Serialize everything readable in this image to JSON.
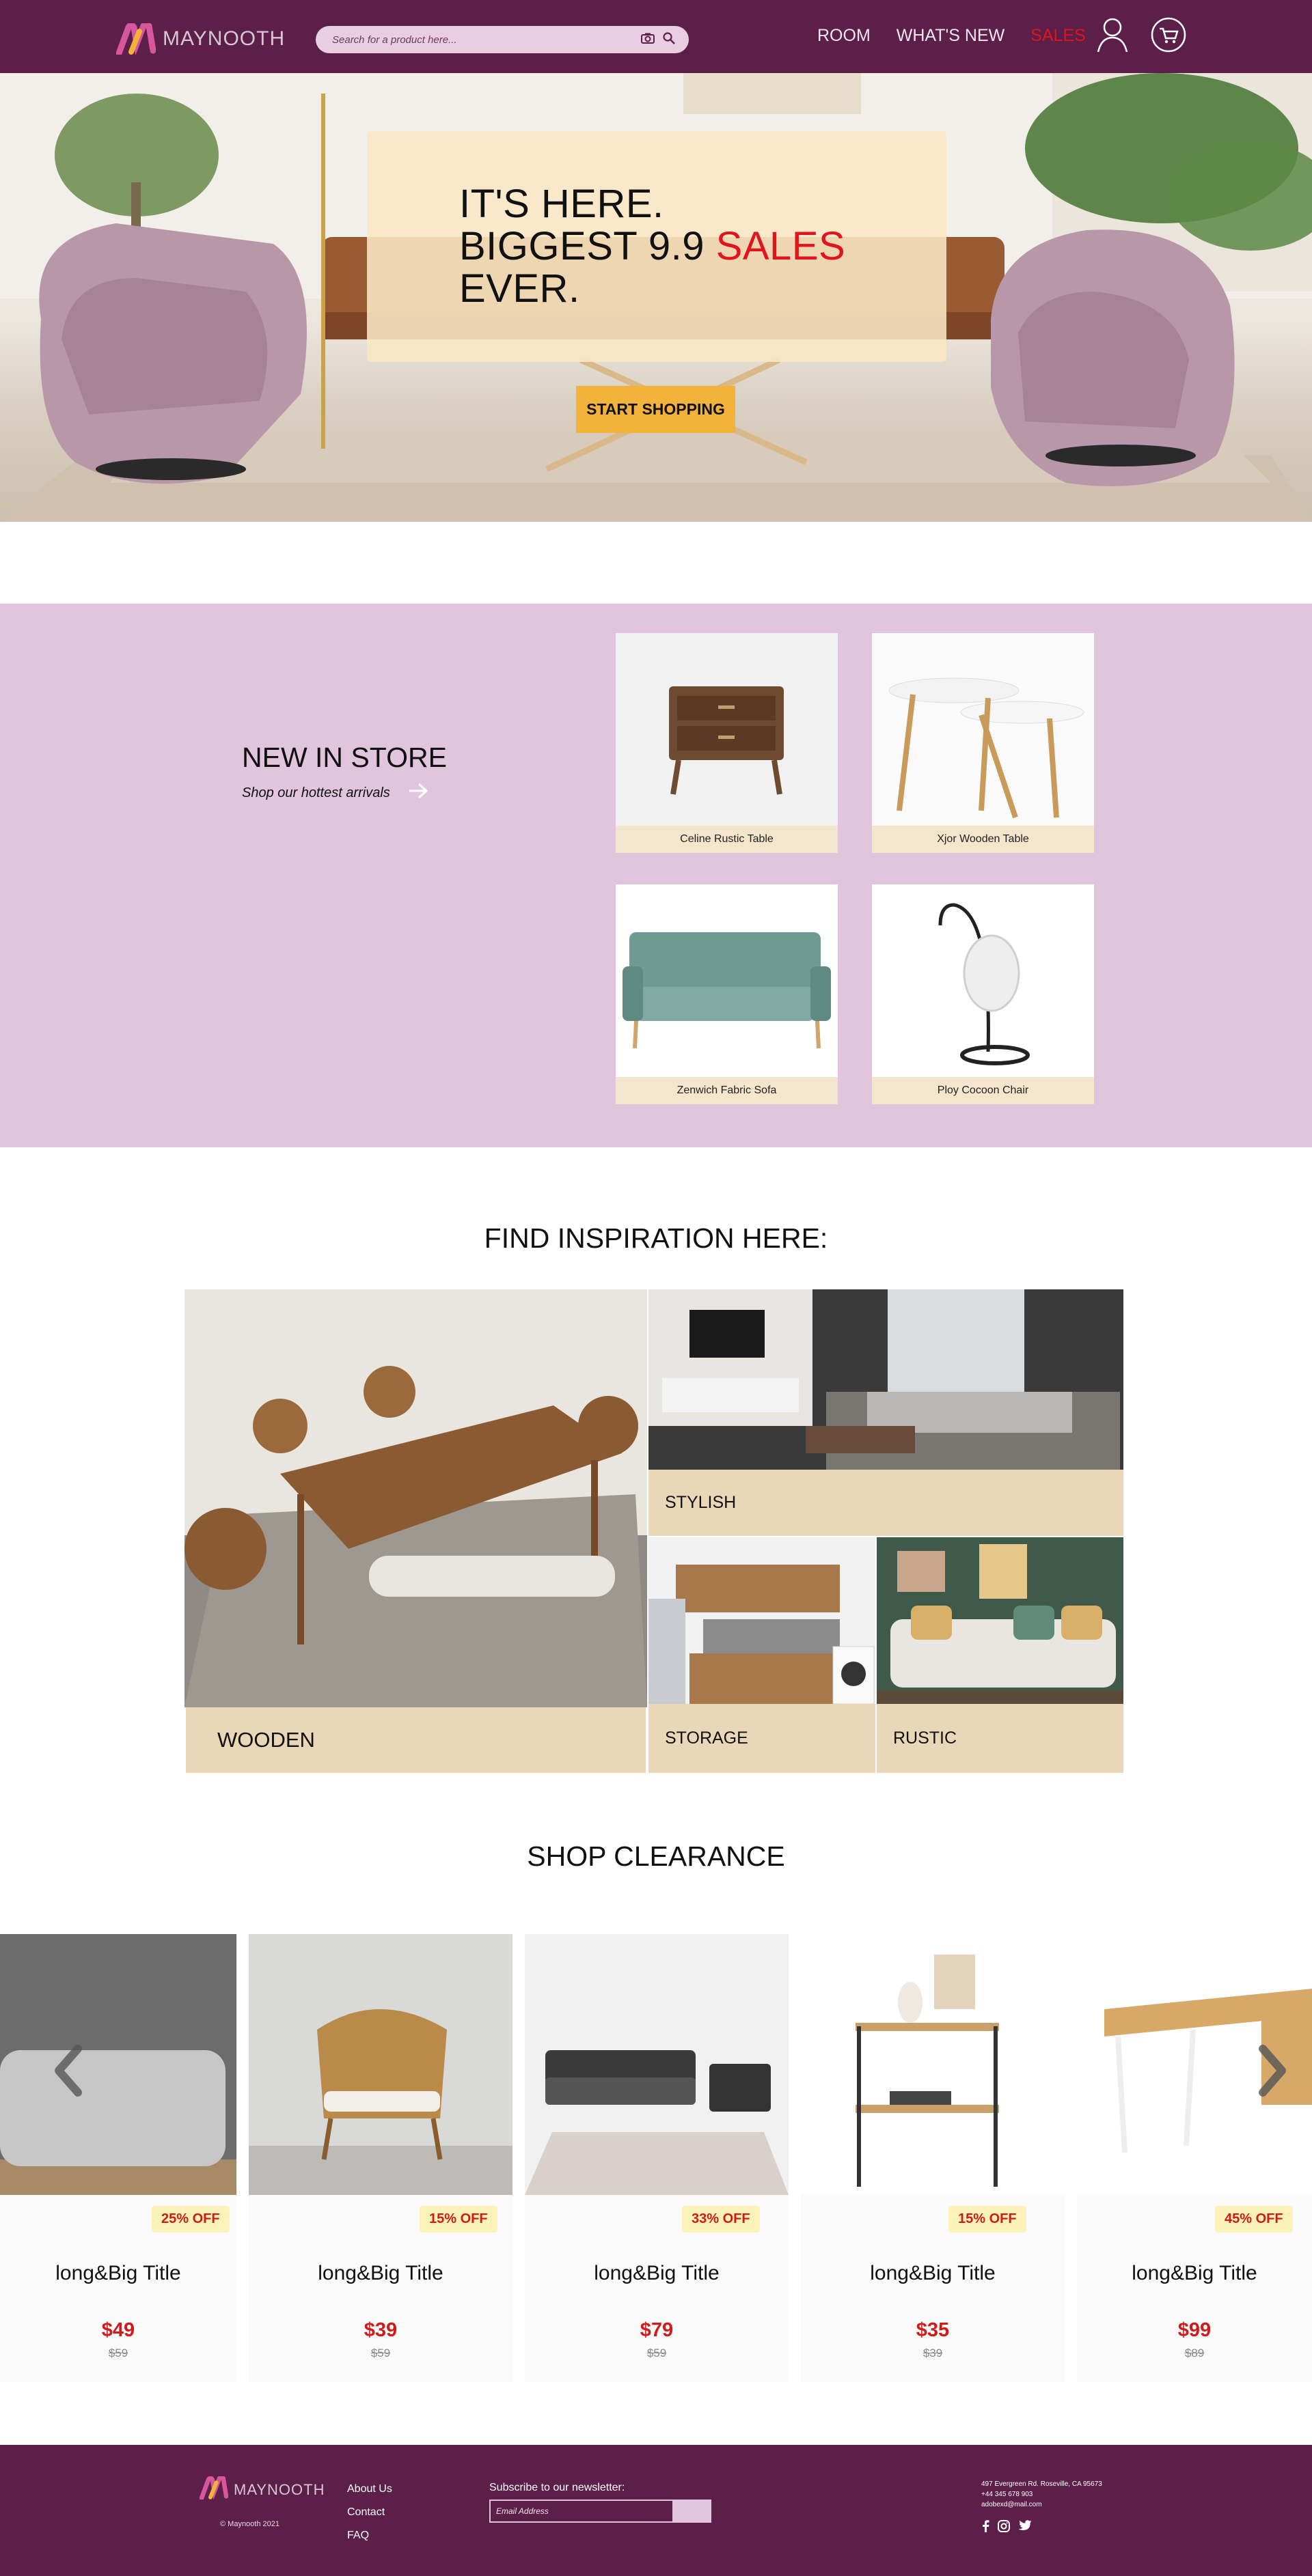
{
  "brand": {
    "name": "MAYNOOTH"
  },
  "search": {
    "placeholder": "Search for a product here..."
  },
  "nav": [
    {
      "label": "ROOM"
    },
    {
      "label": "WHAT'S NEW"
    },
    {
      "label": "SALES"
    }
  ],
  "hero": {
    "line1": "IT'S HERE.",
    "line2_prefix": "BIGGEST 9.9 ",
    "line2_highlight": "SALES",
    "line3": "EVER.",
    "cta": "START SHOPPING"
  },
  "new_in": {
    "title": "NEW IN STORE",
    "subtitle": "Shop our hottest arrivals",
    "products": [
      {
        "name": "Celine Rustic Table"
      },
      {
        "name": "Xjor Wooden Table"
      },
      {
        "name": "Zenwich Fabric Sofa"
      },
      {
        "name": "Ploy Cocoon Chair"
      }
    ]
  },
  "inspiration": {
    "title": "FIND INSPIRATION HERE:",
    "tiles": [
      {
        "label": "WOODEN"
      },
      {
        "label": "STYLISH"
      },
      {
        "label": "STORAGE"
      },
      {
        "label": "RUSTIC"
      }
    ]
  },
  "clearance": {
    "title": "SHOP CLEARANCE",
    "items": [
      {
        "badge": "25% OFF",
        "title": "long&Big Title",
        "price": "$49",
        "old_price": "$59"
      },
      {
        "badge": "15% OFF",
        "title": "long&Big Title",
        "price": "$39",
        "old_price": "$59"
      },
      {
        "badge": "33% OFF",
        "title": "long&Big Title",
        "price": "$79",
        "old_price": "$59"
      },
      {
        "badge": "15% OFF",
        "title": "long&Big Title",
        "price": "$35",
        "old_price": "$39"
      },
      {
        "badge": "45% OFF",
        "title": "long&Big Title",
        "price": "$99",
        "old_price": "$89"
      }
    ]
  },
  "footer": {
    "brand": "MAYNOOTH",
    "copyright": "© Maynooth 2021",
    "links": [
      {
        "label": "About Us"
      },
      {
        "label": "Contact"
      },
      {
        "label": "FAQ"
      }
    ],
    "newsletter_label": "Subscribe to our newsletter:",
    "email_placeholder": "Email Address",
    "submit_label": "",
    "address": "497 Evergreen Rd. Roseville, CA 95673",
    "phone": "+44 345 678 903",
    "email": "adobexd@mail.com"
  },
  "colors": {
    "primary": "#5b1f4a",
    "pink": "#e0c5dc",
    "accent": "#f3b239",
    "sale": "#e1131b",
    "beige": "#ead7b7"
  }
}
